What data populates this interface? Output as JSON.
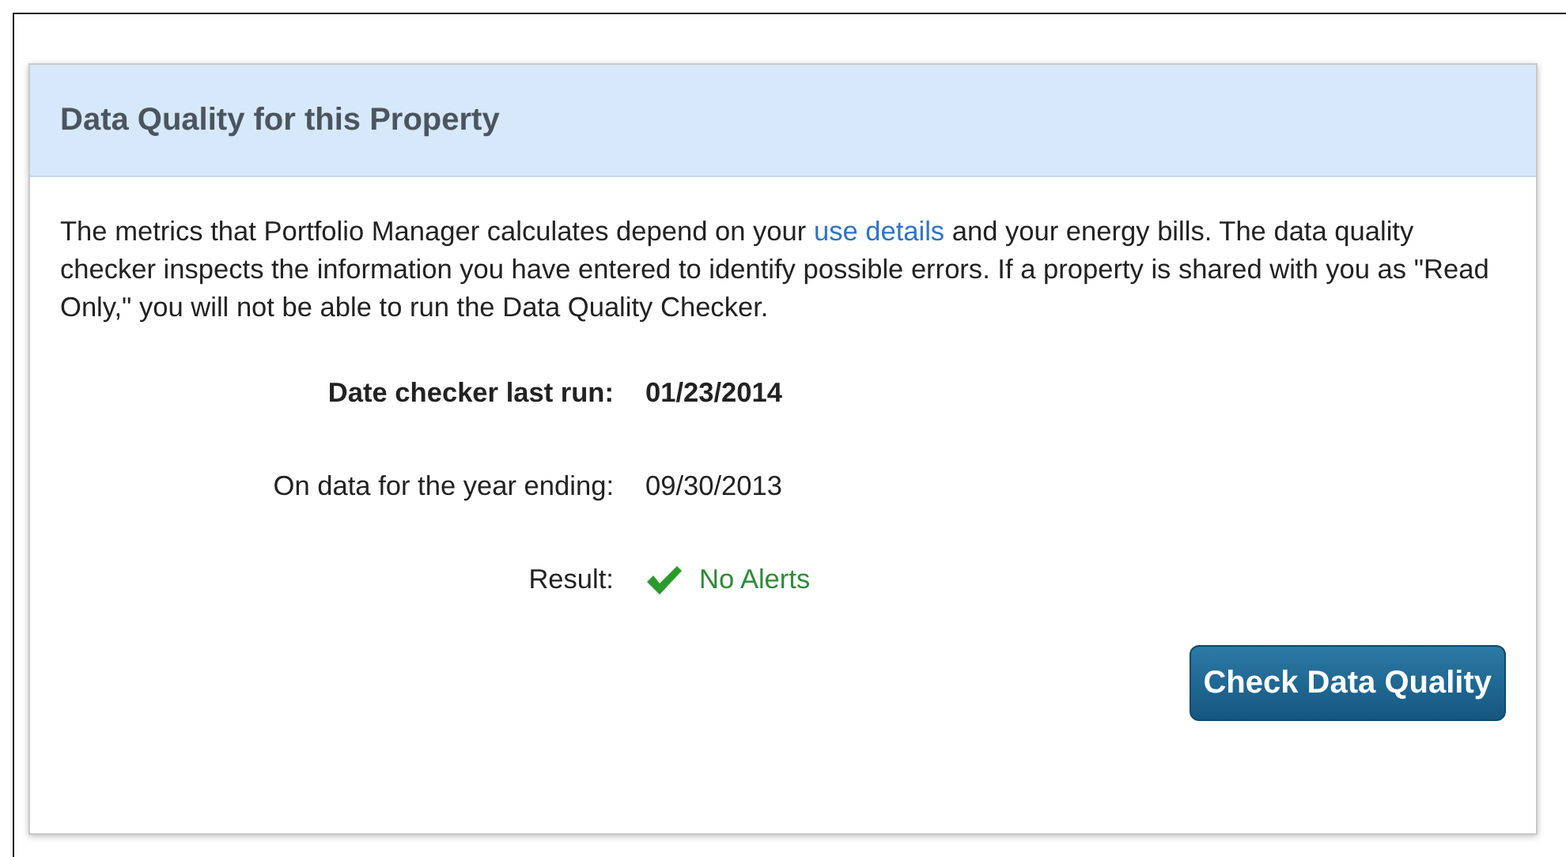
{
  "panel": {
    "title": "Data Quality for this Property",
    "intro": {
      "before": "The metrics that Portfolio Manager calculates depend on your ",
      "link": "use details",
      "after": " and your energy bills. The data quality checker inspects the information you have entered to identify possible errors. If a property is shared with you as \"Read Only,\" you will not be able to run the Data Quality Checker."
    },
    "rows": [
      {
        "kind": "bold",
        "label": "Date checker last run:",
        "value": "01/23/2014"
      },
      {
        "kind": "plain",
        "label": "On data for the year ending:",
        "value": "09/30/2013"
      },
      {
        "kind": "success",
        "label": "Result:",
        "value": "No Alerts"
      }
    ],
    "button": "Check Data Quality"
  }
}
